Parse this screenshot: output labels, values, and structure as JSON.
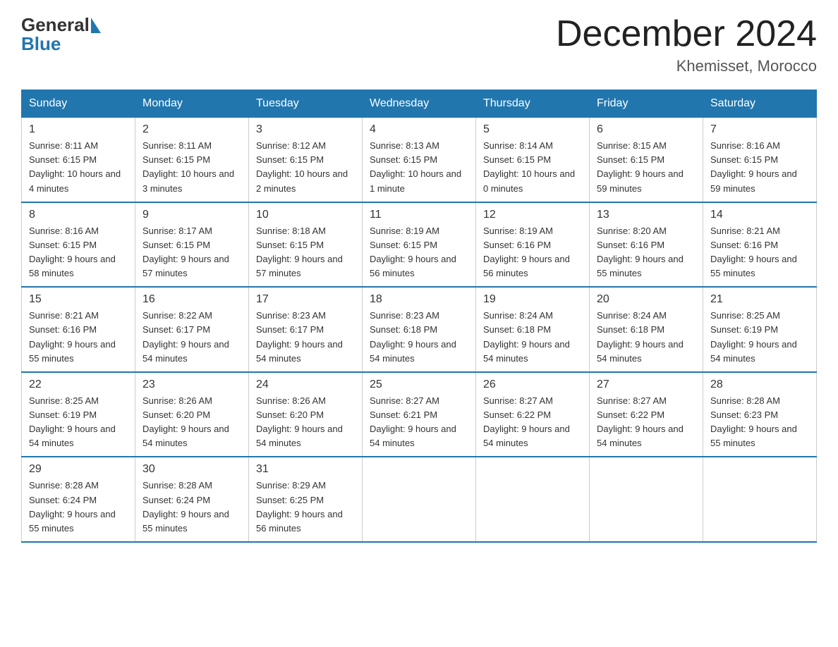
{
  "header": {
    "logo_general": "General",
    "logo_blue": "Blue",
    "month_title": "December 2024",
    "location": "Khemisset, Morocco"
  },
  "days_of_week": [
    "Sunday",
    "Monday",
    "Tuesday",
    "Wednesday",
    "Thursday",
    "Friday",
    "Saturday"
  ],
  "weeks": [
    [
      {
        "day": "1",
        "sunrise": "8:11 AM",
        "sunset": "6:15 PM",
        "daylight": "10 hours and 4 minutes."
      },
      {
        "day": "2",
        "sunrise": "8:11 AM",
        "sunset": "6:15 PM",
        "daylight": "10 hours and 3 minutes."
      },
      {
        "day": "3",
        "sunrise": "8:12 AM",
        "sunset": "6:15 PM",
        "daylight": "10 hours and 2 minutes."
      },
      {
        "day": "4",
        "sunrise": "8:13 AM",
        "sunset": "6:15 PM",
        "daylight": "10 hours and 1 minute."
      },
      {
        "day": "5",
        "sunrise": "8:14 AM",
        "sunset": "6:15 PM",
        "daylight": "10 hours and 0 minutes."
      },
      {
        "day": "6",
        "sunrise": "8:15 AM",
        "sunset": "6:15 PM",
        "daylight": "9 hours and 59 minutes."
      },
      {
        "day": "7",
        "sunrise": "8:16 AM",
        "sunset": "6:15 PM",
        "daylight": "9 hours and 59 minutes."
      }
    ],
    [
      {
        "day": "8",
        "sunrise": "8:16 AM",
        "sunset": "6:15 PM",
        "daylight": "9 hours and 58 minutes."
      },
      {
        "day": "9",
        "sunrise": "8:17 AM",
        "sunset": "6:15 PM",
        "daylight": "9 hours and 57 minutes."
      },
      {
        "day": "10",
        "sunrise": "8:18 AM",
        "sunset": "6:15 PM",
        "daylight": "9 hours and 57 minutes."
      },
      {
        "day": "11",
        "sunrise": "8:19 AM",
        "sunset": "6:15 PM",
        "daylight": "9 hours and 56 minutes."
      },
      {
        "day": "12",
        "sunrise": "8:19 AM",
        "sunset": "6:16 PM",
        "daylight": "9 hours and 56 minutes."
      },
      {
        "day": "13",
        "sunrise": "8:20 AM",
        "sunset": "6:16 PM",
        "daylight": "9 hours and 55 minutes."
      },
      {
        "day": "14",
        "sunrise": "8:21 AM",
        "sunset": "6:16 PM",
        "daylight": "9 hours and 55 minutes."
      }
    ],
    [
      {
        "day": "15",
        "sunrise": "8:21 AM",
        "sunset": "6:16 PM",
        "daylight": "9 hours and 55 minutes."
      },
      {
        "day": "16",
        "sunrise": "8:22 AM",
        "sunset": "6:17 PM",
        "daylight": "9 hours and 54 minutes."
      },
      {
        "day": "17",
        "sunrise": "8:23 AM",
        "sunset": "6:17 PM",
        "daylight": "9 hours and 54 minutes."
      },
      {
        "day": "18",
        "sunrise": "8:23 AM",
        "sunset": "6:18 PM",
        "daylight": "9 hours and 54 minutes."
      },
      {
        "day": "19",
        "sunrise": "8:24 AM",
        "sunset": "6:18 PM",
        "daylight": "9 hours and 54 minutes."
      },
      {
        "day": "20",
        "sunrise": "8:24 AM",
        "sunset": "6:18 PM",
        "daylight": "9 hours and 54 minutes."
      },
      {
        "day": "21",
        "sunrise": "8:25 AM",
        "sunset": "6:19 PM",
        "daylight": "9 hours and 54 minutes."
      }
    ],
    [
      {
        "day": "22",
        "sunrise": "8:25 AM",
        "sunset": "6:19 PM",
        "daylight": "9 hours and 54 minutes."
      },
      {
        "day": "23",
        "sunrise": "8:26 AM",
        "sunset": "6:20 PM",
        "daylight": "9 hours and 54 minutes."
      },
      {
        "day": "24",
        "sunrise": "8:26 AM",
        "sunset": "6:20 PM",
        "daylight": "9 hours and 54 minutes."
      },
      {
        "day": "25",
        "sunrise": "8:27 AM",
        "sunset": "6:21 PM",
        "daylight": "9 hours and 54 minutes."
      },
      {
        "day": "26",
        "sunrise": "8:27 AM",
        "sunset": "6:22 PM",
        "daylight": "9 hours and 54 minutes."
      },
      {
        "day": "27",
        "sunrise": "8:27 AM",
        "sunset": "6:22 PM",
        "daylight": "9 hours and 54 minutes."
      },
      {
        "day": "28",
        "sunrise": "8:28 AM",
        "sunset": "6:23 PM",
        "daylight": "9 hours and 55 minutes."
      }
    ],
    [
      {
        "day": "29",
        "sunrise": "8:28 AM",
        "sunset": "6:24 PM",
        "daylight": "9 hours and 55 minutes."
      },
      {
        "day": "30",
        "sunrise": "8:28 AM",
        "sunset": "6:24 PM",
        "daylight": "9 hours and 55 minutes."
      },
      {
        "day": "31",
        "sunrise": "8:29 AM",
        "sunset": "6:25 PM",
        "daylight": "9 hours and 56 minutes."
      },
      null,
      null,
      null,
      null
    ]
  ]
}
